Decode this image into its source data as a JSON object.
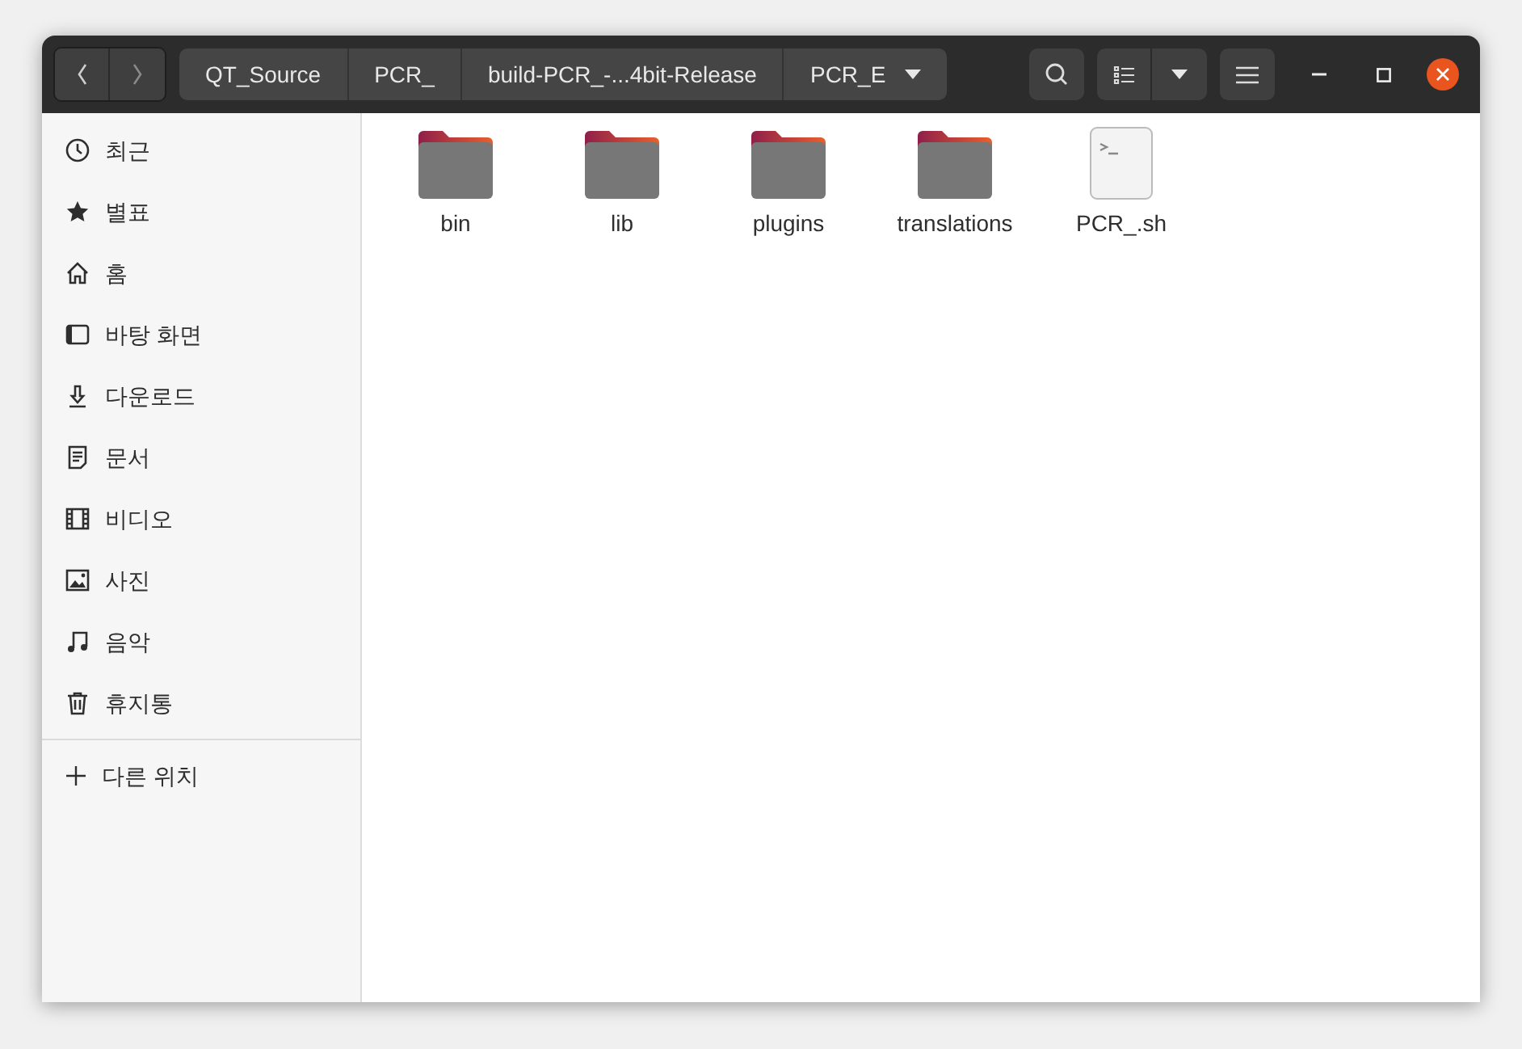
{
  "path_bar": [
    {
      "label": "QT_Source"
    },
    {
      "label": "PCR_"
    },
    {
      "label": "build-PCR_-...4bit-Release"
    },
    {
      "label": "PCR_E",
      "menu": true
    }
  ],
  "sidebar": {
    "items": [
      {
        "label": "최근",
        "kind": "recent"
      },
      {
        "label": "별표",
        "kind": "starred"
      },
      {
        "label": "홈",
        "kind": "home"
      },
      {
        "label": "바탕 화면",
        "kind": "desktop"
      },
      {
        "label": "다운로드",
        "kind": "downloads"
      },
      {
        "label": "문서",
        "kind": "documents"
      },
      {
        "label": "비디오",
        "kind": "videos"
      },
      {
        "label": "사진",
        "kind": "pictures"
      },
      {
        "label": "음악",
        "kind": "music"
      },
      {
        "label": "휴지통",
        "kind": "trash"
      }
    ],
    "other_locations": {
      "label": "다른 위치"
    }
  },
  "files": [
    {
      "name": "bin",
      "kind": "folder"
    },
    {
      "name": "lib",
      "kind": "folder"
    },
    {
      "name": "plugins",
      "kind": "folder"
    },
    {
      "name": "translations",
      "kind": "folder"
    },
    {
      "name": "PCR_.sh",
      "kind": "script"
    }
  ]
}
